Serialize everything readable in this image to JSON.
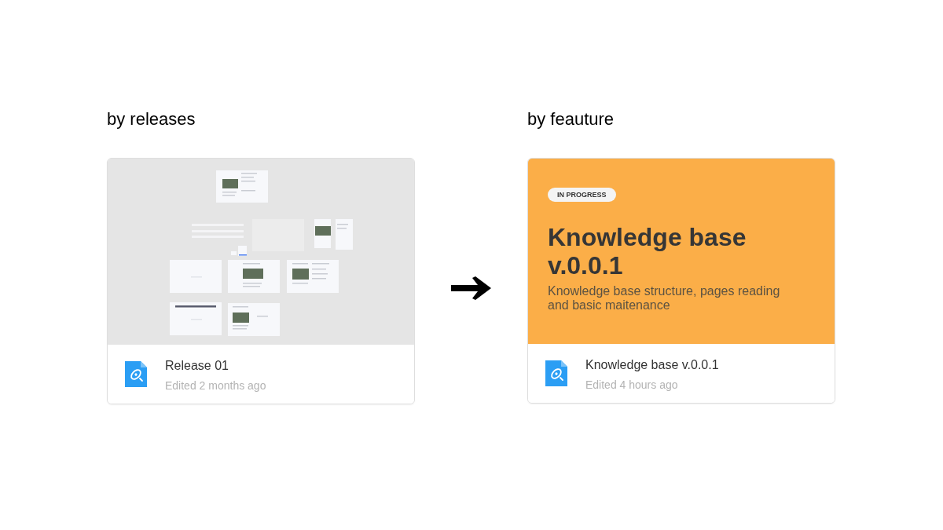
{
  "sections": [
    {
      "heading": "by releases",
      "card": {
        "kind": "thumbnail",
        "title": "Release 01",
        "edited": "Edited 2 months ago"
      }
    },
    {
      "heading": "by feauture",
      "card": {
        "kind": "cover",
        "badge": "IN PROGRESS",
        "cover_title": "Knowledge base v.0.0.1",
        "cover_description": "Knowledge base structure, pages reading and basic maitenance",
        "title": "Knowledge base v.0.0.1",
        "edited": "Edited 4 hours ago"
      }
    }
  ]
}
